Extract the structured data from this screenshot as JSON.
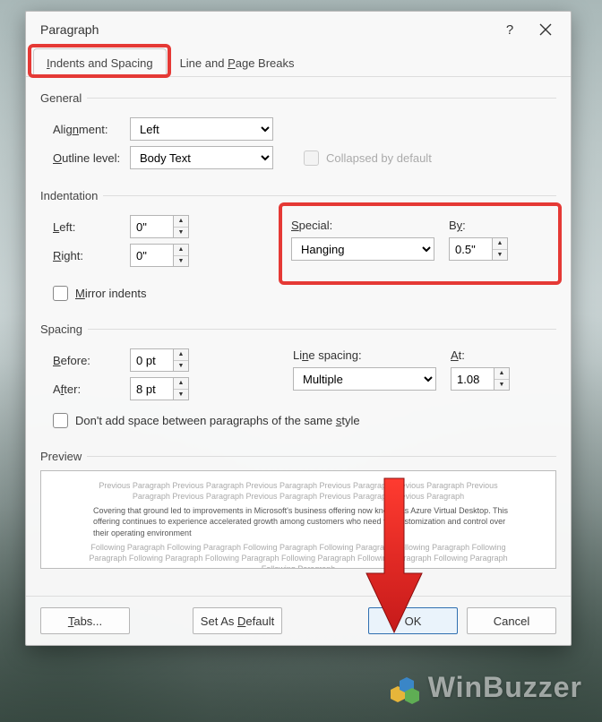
{
  "dialog": {
    "title": "Paragraph",
    "help_symbol": "?",
    "tabs": {
      "indents": "Indents and Spacing",
      "breaks": "Line and Page Breaks"
    }
  },
  "general": {
    "legend": "General",
    "alignment_label": "Alignment:",
    "alignment_value": "Left",
    "outline_label": "Outline level:",
    "outline_value": "Body Text",
    "collapsed_label": "Collapsed by default"
  },
  "indentation": {
    "legend": "Indentation",
    "left_label": "Left:",
    "left_value": "0\"",
    "right_label": "Right:",
    "right_value": "0\"",
    "special_label": "Special:",
    "special_value": "Hanging",
    "by_label": "By:",
    "by_value": "0.5\"",
    "mirror_label": "Mirror indents"
  },
  "spacing": {
    "legend": "Spacing",
    "before_label": "Before:",
    "before_value": "0 pt",
    "after_label": "After:",
    "after_value": "8 pt",
    "line_label": "Line spacing:",
    "line_value": "Multiple",
    "at_label": "At:",
    "at_value": "1.08",
    "dont_add_label": "Don't add space between paragraphs of the same style"
  },
  "preview": {
    "legend": "Preview",
    "prev_text": "Previous Paragraph Previous Paragraph Previous Paragraph Previous Paragraph Previous Paragraph Previous Paragraph Previous Paragraph Previous Paragraph Previous Paragraph Previous Paragraph",
    "sample_text": "Covering that ground led to improvements in Microsoft's business offering now known as Azure Virtual Desktop. This offering continues to experience accelerated growth among customers who need full customization and control over their operating environment",
    "next_text": "Following Paragraph Following Paragraph Following Paragraph Following Paragraph Following Paragraph Following Paragraph Following Paragraph Following Paragraph Following Paragraph Following Paragraph Following Paragraph Following Paragraph"
  },
  "buttons": {
    "tabs": "Tabs...",
    "default": "Set As Default",
    "ok": "OK",
    "cancel": "Cancel"
  },
  "watermark": "WinBuzzer"
}
